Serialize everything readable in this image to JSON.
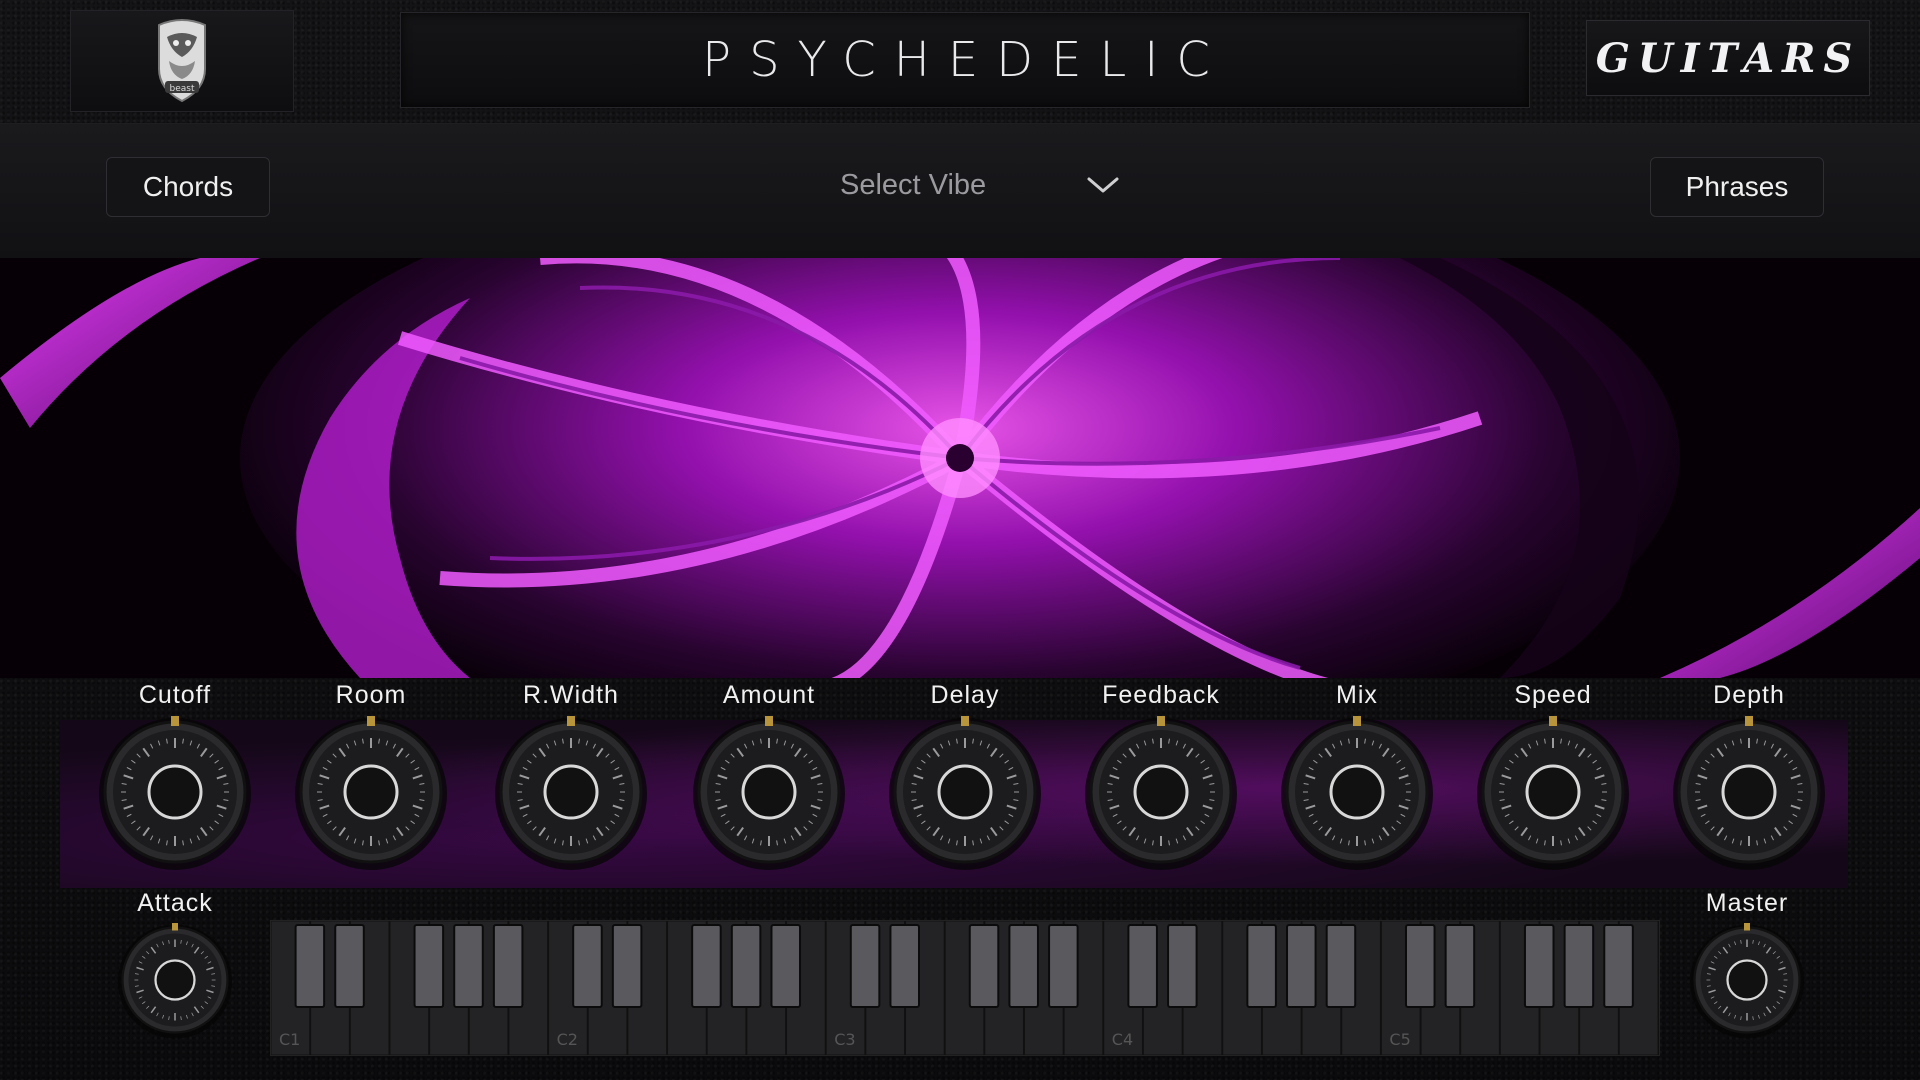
{
  "header": {
    "logo_icon": "beast-crest-icon",
    "title": "PSYCHEDELIC",
    "brand": "GUITARS"
  },
  "controls": {
    "chords_label": "Chords",
    "vibe_label": "Select Vibe",
    "phrases_label": "Phrases"
  },
  "knobs": [
    {
      "label": "Cutoff"
    },
    {
      "label": "Room"
    },
    {
      "label": "R.Width"
    },
    {
      "label": "Amount"
    },
    {
      "label": "Delay"
    },
    {
      "label": "Feedback"
    },
    {
      "label": "Mix"
    },
    {
      "label": "Speed"
    },
    {
      "label": "Depth"
    }
  ],
  "attack": {
    "label": "Attack"
  },
  "master": {
    "label": "Master"
  },
  "keyboard": {
    "octave_labels": [
      "C1",
      "C2",
      "C3",
      "C4",
      "C5"
    ]
  },
  "colors": {
    "accent": "#c21ee0",
    "knob_marker": "#b8953a"
  }
}
